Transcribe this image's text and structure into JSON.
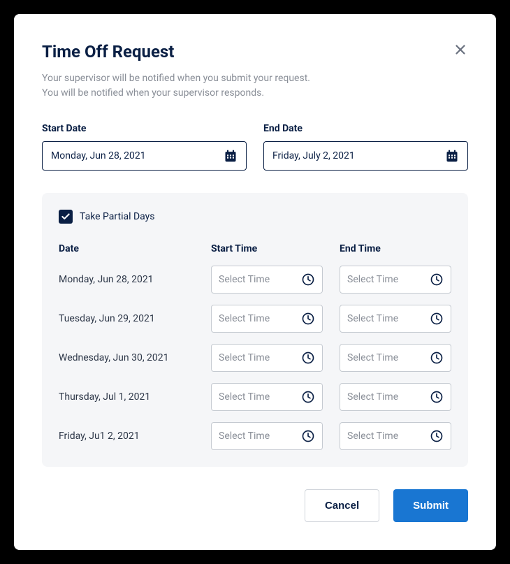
{
  "modal": {
    "title": "Time Off Request",
    "descriptionLine1": "Your supervisor will be notified when you submit your request.",
    "descriptionLine2": "You will be notified when your supervisor responds."
  },
  "startDate": {
    "label": "Start Date",
    "value": "Monday, Jun 28, 2021"
  },
  "endDate": {
    "label": "End Date",
    "value": "Friday, July 2, 2021"
  },
  "partial": {
    "checkboxLabel": "Take Partial Days",
    "checked": true,
    "headers": {
      "date": "Date",
      "startTime": "Start Time",
      "endTime": "End Time"
    },
    "timePlaceholder": "Select Time",
    "rows": [
      {
        "date": "Monday, Jun 28, 2021"
      },
      {
        "date": "Tuesday, Jun 29, 2021"
      },
      {
        "date": "Wednesday, Jun 30, 2021"
      },
      {
        "date": "Thursday, Jul 1, 2021"
      },
      {
        "date": "Friday, Ju1 2, 2021"
      }
    ]
  },
  "footer": {
    "cancelLabel": "Cancel",
    "submitLabel": "Submit"
  }
}
